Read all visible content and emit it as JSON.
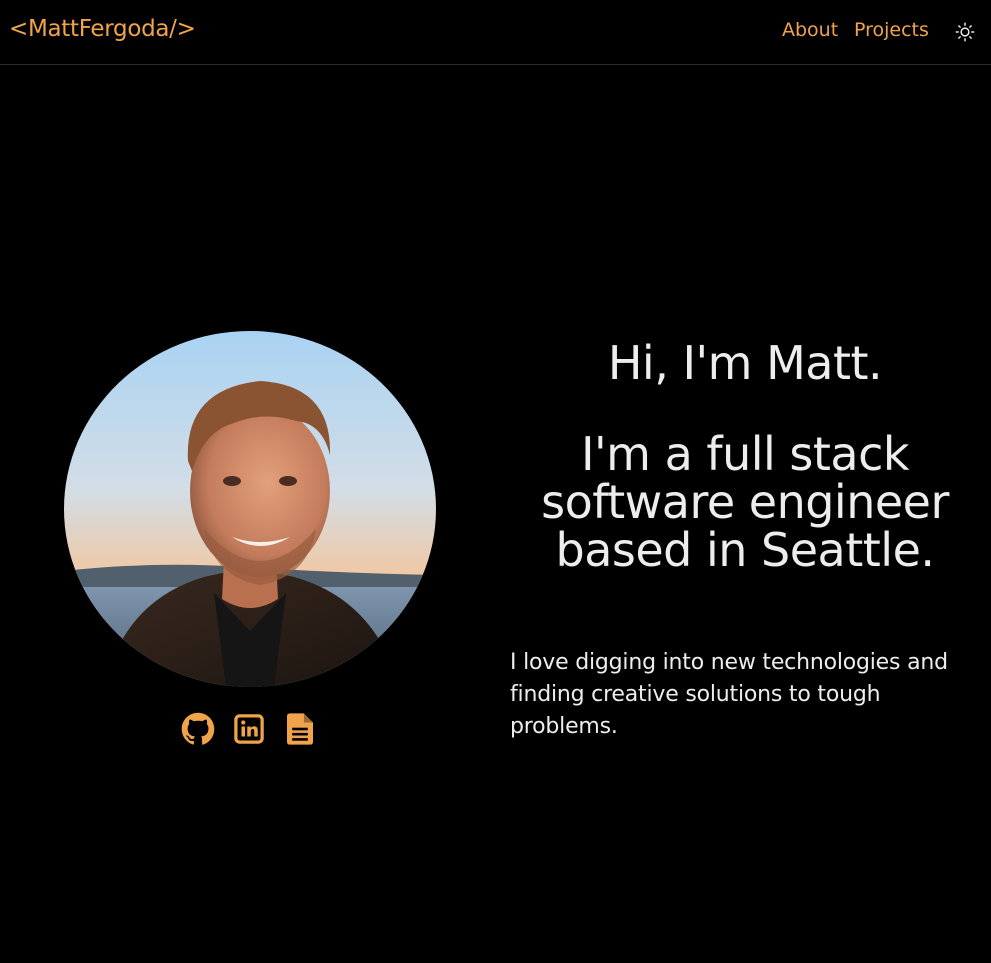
{
  "nav": {
    "logo": "<MattFergoda/>",
    "links": [
      {
        "label": "About"
      },
      {
        "label": "Projects"
      }
    ],
    "theme_toggle_icon": "sun-icon"
  },
  "hero": {
    "greeting": "Hi, I'm Matt.",
    "tagline_lines": [
      "I'm a full stack",
      "software engineer",
      "based in Seattle."
    ],
    "blurb": "I love digging into new technologies and finding creative solutions to tough problems."
  },
  "avatar": {
    "alt_icon": "profile-photo"
  },
  "socials": [
    {
      "icon": "github-icon"
    },
    {
      "icon": "linkedin-icon"
    },
    {
      "icon": "resume-document-icon"
    }
  ],
  "colors": {
    "background": "#000000",
    "accent": "#f0a34a",
    "text": "#ededed"
  }
}
